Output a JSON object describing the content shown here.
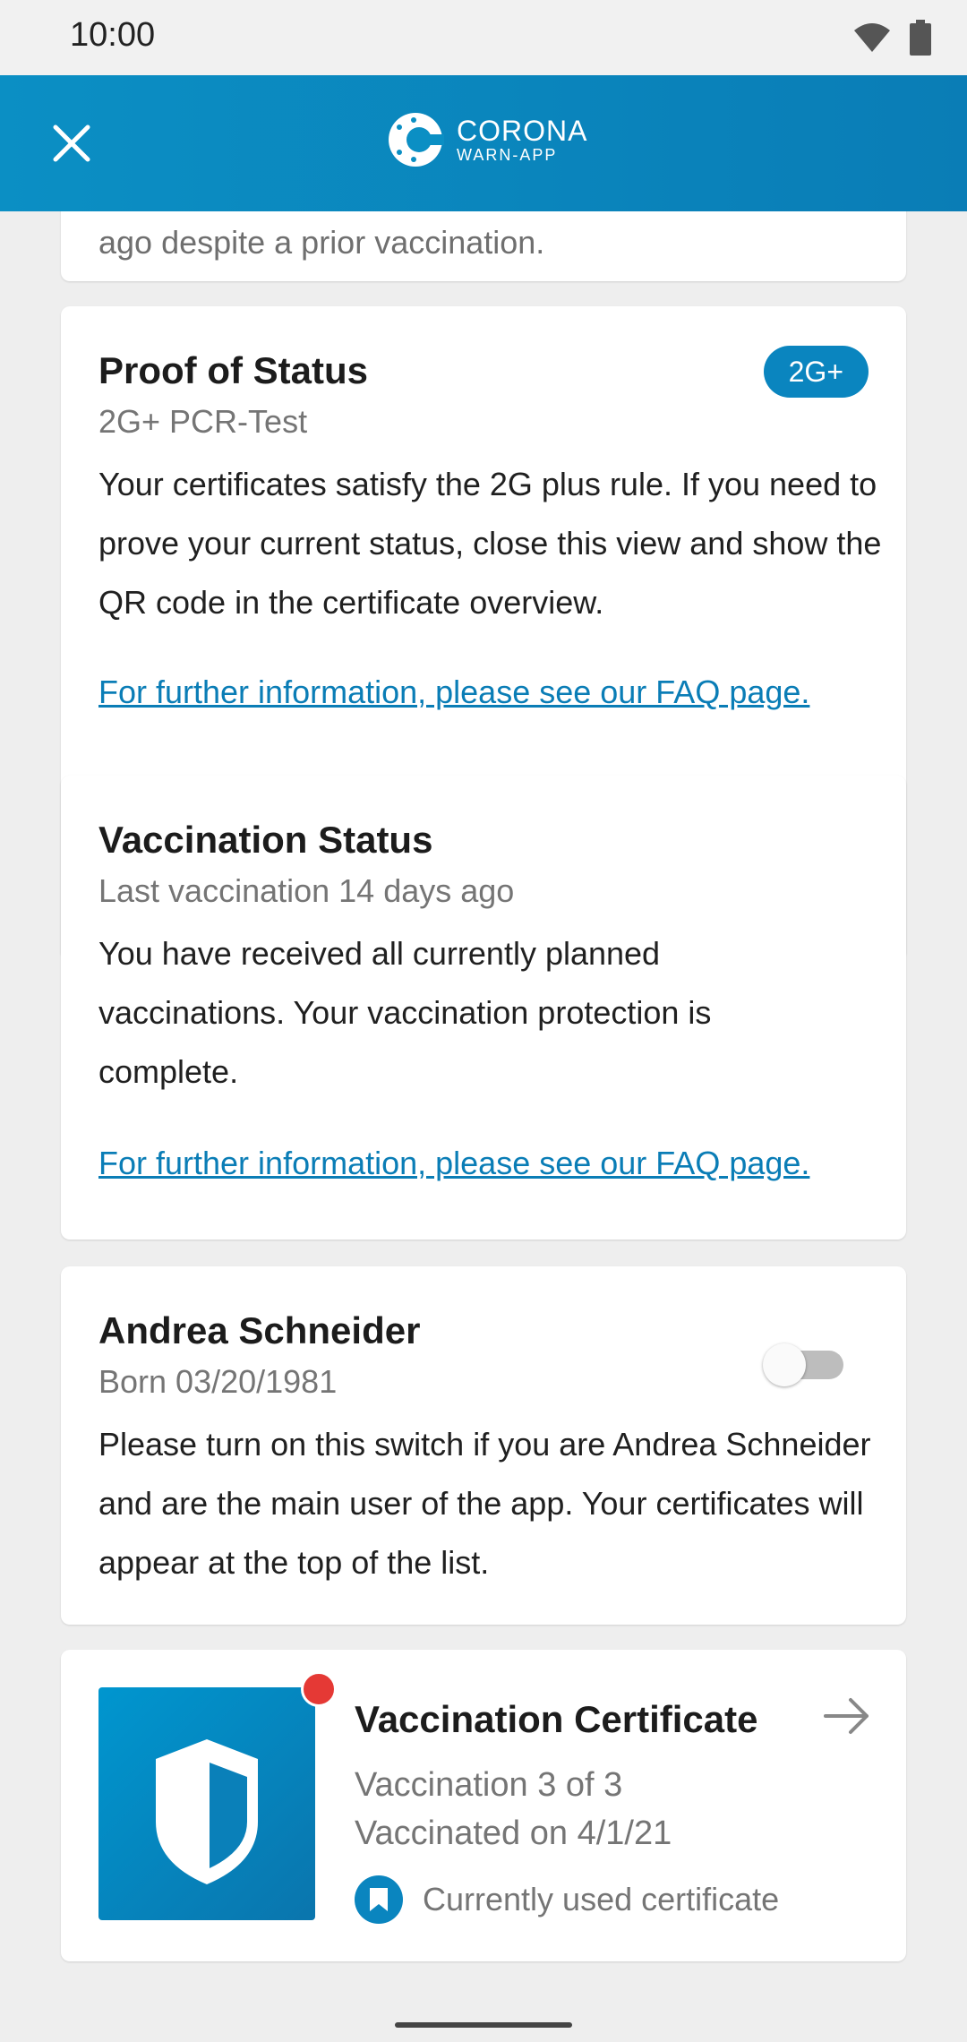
{
  "status_bar": {
    "time": "10:00"
  },
  "app_bar": {
    "brand_line1": "CORONA",
    "brand_line2": "WARN-APP"
  },
  "top_card": {
    "text": "ago despite a prior vaccination."
  },
  "proof_card": {
    "title": "Proof of Status",
    "badge": "2G+",
    "subtitle": "2G+ PCR-Test",
    "body": "Your certificates satisfy the 2G plus rule. If you need to prove your current status, close this view and show the QR code in the certificate overview.",
    "link": "For further information, please see our FAQ page."
  },
  "vaccination_status_card": {
    "title": "Vaccination Status",
    "subtitle": "Last vaccination 14 days ago",
    "body": "You have received all currently planned vaccinations. Your vaccination protection is complete.",
    "link": "For further information, please see our FAQ page."
  },
  "person_card": {
    "name": "Andrea Schneider",
    "born": "Born 03/20/1981",
    "body": "Please turn on this switch if you are Andrea Schneider and are the main user of the app. Your certificates will appear at the top of the list.",
    "toggle_on": false
  },
  "certificate_card": {
    "title": "Vaccination Certificate",
    "line1": "Vaccination 3 of 3",
    "line2": "Vaccinated on 4/1/21",
    "status": "Currently used certificate"
  },
  "colors": {
    "brand": "#0a85bf",
    "link": "#0a7db6",
    "notification_dot": "#e53935"
  }
}
